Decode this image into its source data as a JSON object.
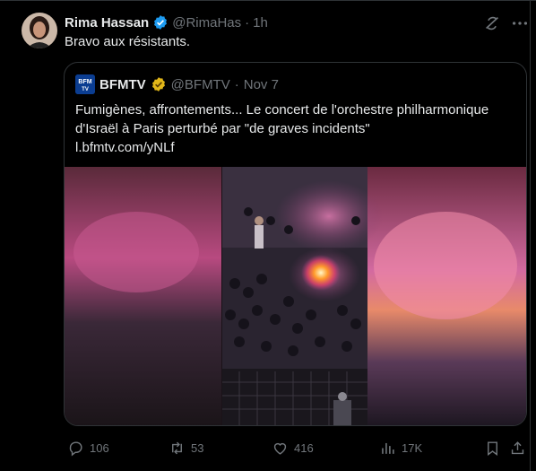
{
  "tweet": {
    "author_name": "Rima Hassan",
    "author_handle": "@RimaHas",
    "separator": "·",
    "time": "1h",
    "text": "Bravo aux résistants."
  },
  "quoted": {
    "author_name": "BFMTV",
    "author_handle": "@BFMTV",
    "separator": "·",
    "date": "Nov 7",
    "avatar_text": "BFM TV",
    "text": "Fumigènes, affrontements... Le concert de l'orchestre philharmonique d'Israël à Paris perturbé par \"de graves incidents\"",
    "link": "l.bfmtv.com/yNLf"
  },
  "actions": {
    "replies": "106",
    "reposts": "53",
    "likes": "416",
    "views": "17K"
  },
  "colors": {
    "background": "#000000",
    "text_primary": "#e7e9ea",
    "text_secondary": "#71767b",
    "verified_blue": "#1d9bf0",
    "verified_gold": "#e2b719",
    "border": "#2f3336"
  },
  "icons": [
    "verified-badge-icon",
    "grok-icon",
    "more-icon",
    "gold-verified-icon",
    "reply-icon",
    "repost-icon",
    "like-icon",
    "views-icon",
    "bookmark-icon",
    "share-icon"
  ]
}
